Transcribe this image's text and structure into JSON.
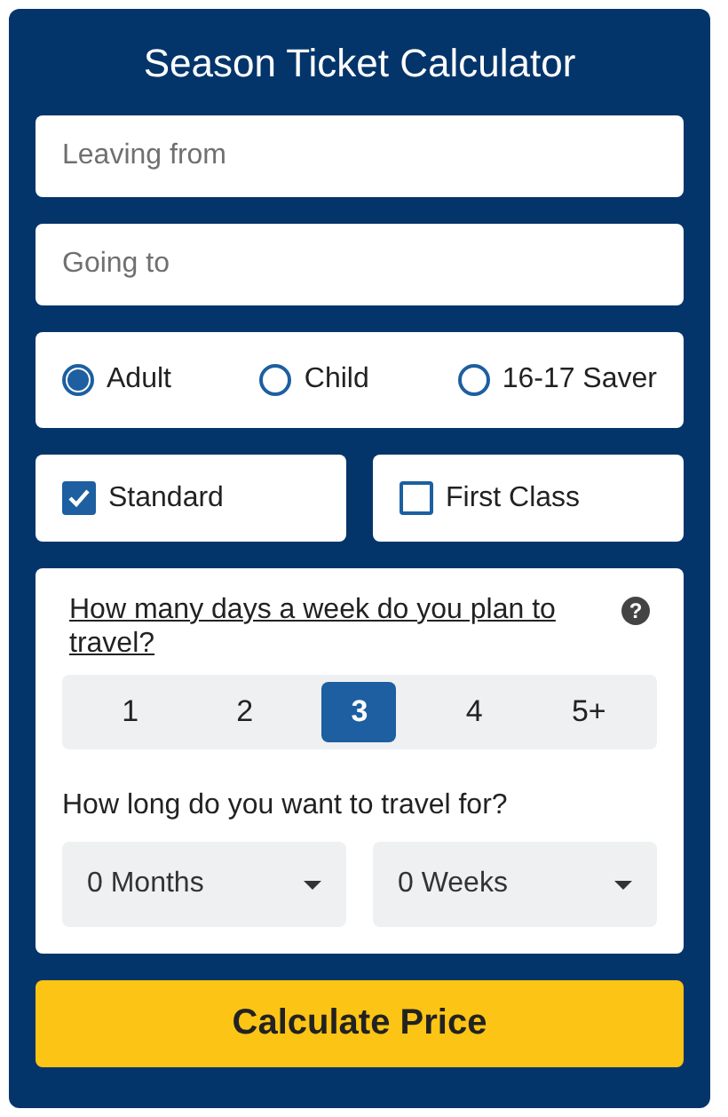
{
  "title": "Season Ticket Calculator",
  "from": {
    "placeholder": "Leaving from"
  },
  "to": {
    "placeholder": "Going to"
  },
  "passengers": [
    {
      "label": "Adult",
      "selected": true
    },
    {
      "label": "Child",
      "selected": false
    },
    {
      "label": "16-17 Saver",
      "selected": false
    }
  ],
  "classes": [
    {
      "label": "Standard",
      "checked": true
    },
    {
      "label": "First Class",
      "checked": false
    }
  ],
  "days": {
    "question": "How many days a week do you plan to travel?",
    "help_icon": "?",
    "options": [
      {
        "label": "1",
        "selected": false
      },
      {
        "label": "2",
        "selected": false
      },
      {
        "label": "3",
        "selected": true
      },
      {
        "label": "4",
        "selected": false
      },
      {
        "label": "5+",
        "selected": false
      }
    ]
  },
  "duration": {
    "question": "How long do you want to travel for?",
    "selects": [
      "0 Months",
      "0 Weeks"
    ]
  },
  "button": "Calculate Price"
}
